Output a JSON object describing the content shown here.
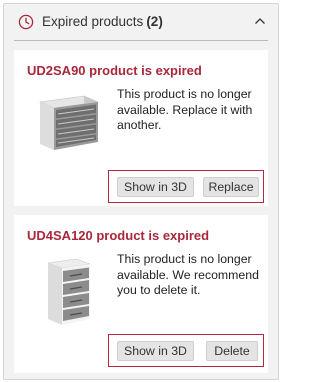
{
  "panel": {
    "title": "Expired products",
    "count": "(2)",
    "accent_color": "#a8283a",
    "icons": {
      "status": "clock-icon",
      "collapse": "chevron-up-icon"
    }
  },
  "products": [
    {
      "title": "UD2SA90 product is expired",
      "message": "This product is no longer available. Replace it with another.",
      "thumbnail": "base-cabinet-drawers-image",
      "buttons": {
        "show3d": "Show in 3D",
        "action": "Replace"
      }
    },
    {
      "title": "UD4SA120 product is expired",
      "message": "This product is no longer available. We recommend you to delete it.",
      "thumbnail": "drawer-unit-image",
      "buttons": {
        "show3d": "Show in 3D",
        "action": "Delete"
      }
    }
  ]
}
